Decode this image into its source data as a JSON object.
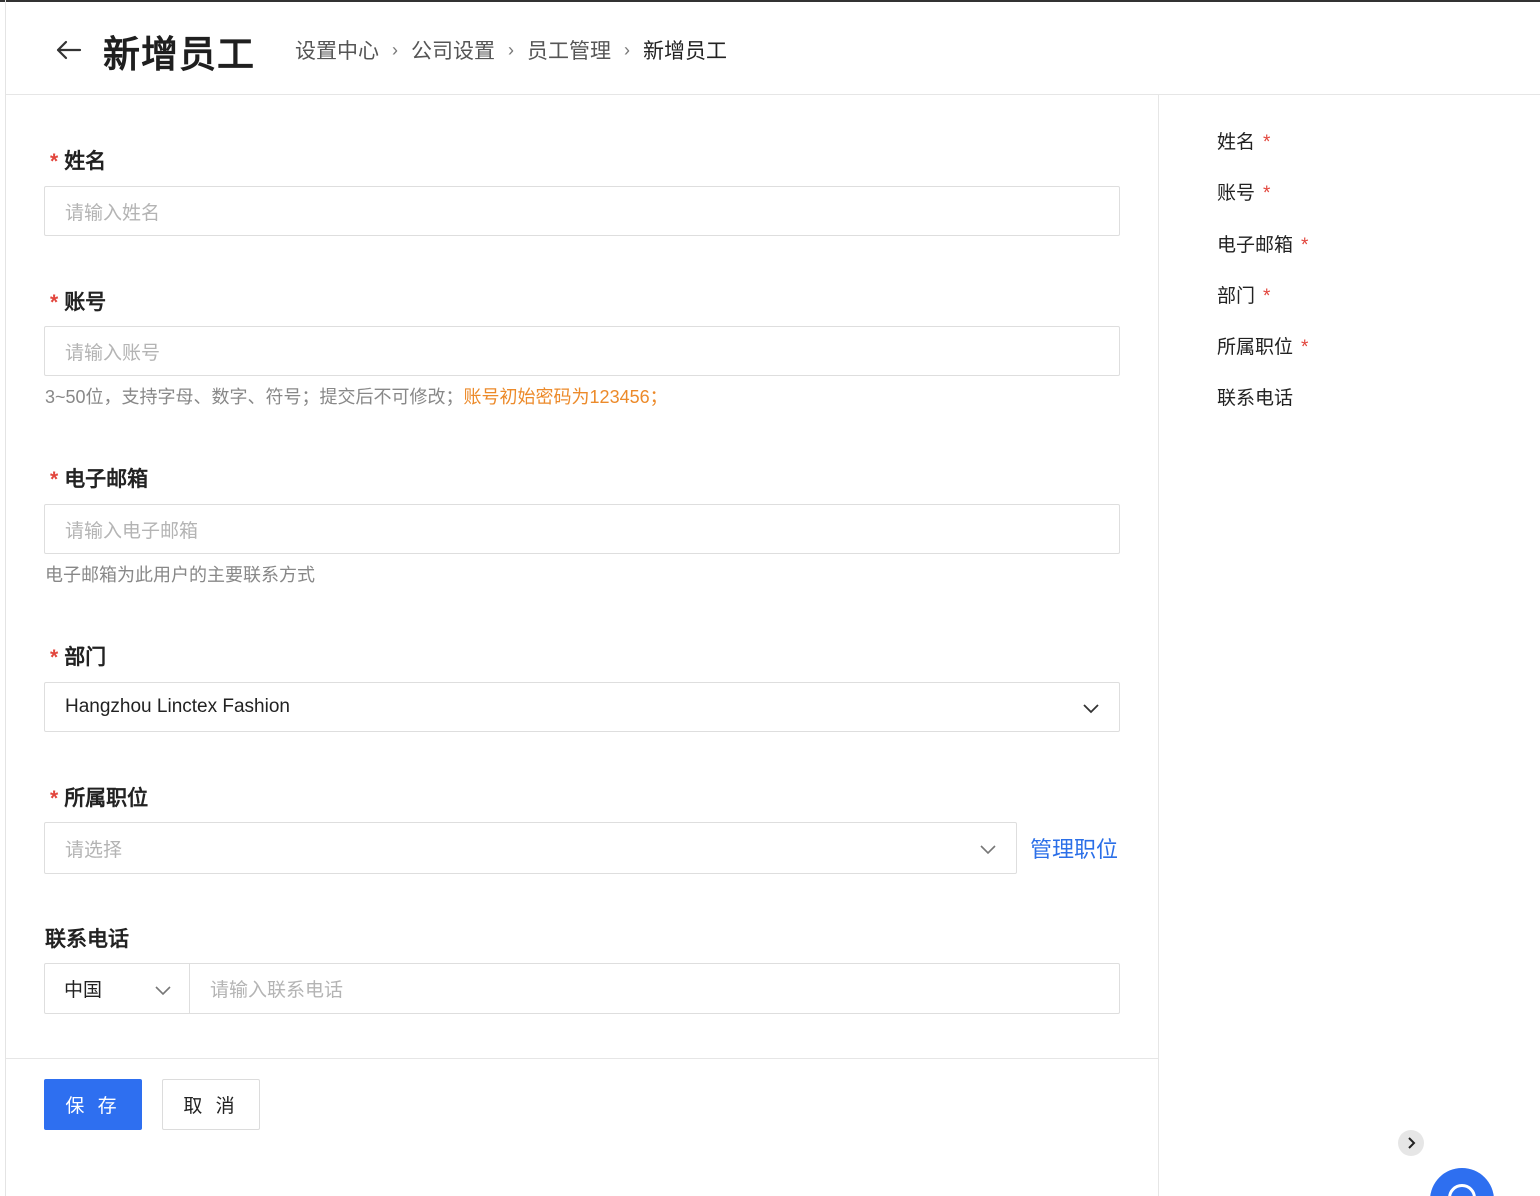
{
  "header": {
    "title": "新增员工",
    "breadcrumb": [
      "设置中心",
      "公司设置",
      "员工管理",
      "新增员工"
    ]
  },
  "form": {
    "name": {
      "label": "姓名",
      "placeholder": "请输入姓名"
    },
    "account": {
      "label": "账号",
      "placeholder": "请输入账号",
      "hint": "3~50位，支持字母、数字、符号；提交后不可修改；",
      "hint_warning": "账号初始密码为123456；"
    },
    "email": {
      "label": "电子邮箱",
      "placeholder": "请输入电子邮箱",
      "hint": "电子邮箱为此用户的主要联系方式"
    },
    "department": {
      "label": "部门",
      "value": "Hangzhou Linctex Fashion"
    },
    "position": {
      "label": "所属职位",
      "placeholder": "请选择",
      "manage_link": "管理职位"
    },
    "phone": {
      "label": "联系电话",
      "country": "中国",
      "placeholder": "请输入联系电话"
    },
    "required_mark": "*"
  },
  "actions": {
    "save": "保 存",
    "cancel": "取 消"
  },
  "anchor_nav": [
    {
      "label": "姓名",
      "required": "*"
    },
    {
      "label": "账号",
      "required": "*"
    },
    {
      "label": "电子邮箱",
      "required": "*"
    },
    {
      "label": "部门",
      "required": "*"
    },
    {
      "label": "所属职位",
      "required": "*"
    },
    {
      "label": "联系电话",
      "required": ""
    }
  ],
  "colors": {
    "primary": "#2e6ff0",
    "required": "#e2453c",
    "warning": "#ec8a2a"
  }
}
